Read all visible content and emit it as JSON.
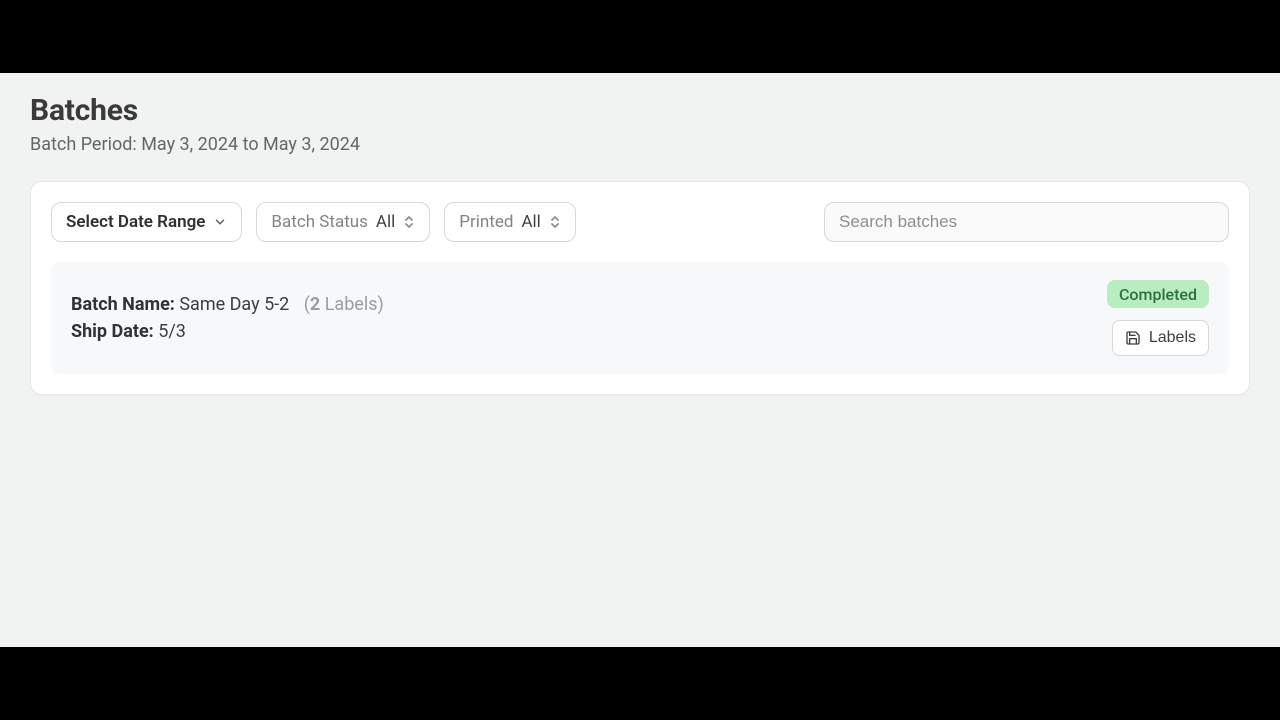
{
  "header": {
    "title": "Batches",
    "subtitle": "Batch Period: May 3, 2024 to May 3, 2024"
  },
  "filters": {
    "date_range_label": "Select Date Range",
    "batch_status_prefix": "Batch Status",
    "batch_status_value": "All",
    "printed_prefix": "Printed",
    "printed_value": "All",
    "search_placeholder": "Search batches"
  },
  "batches": [
    {
      "name_key": "Batch Name:",
      "name_value": "Same Day 5-2",
      "labels_count": "2",
      "labels_word": "Labels",
      "ship_date_key": "Ship Date:",
      "ship_date_value": "5/3",
      "status": "Completed",
      "labels_button": "Labels"
    }
  ]
}
